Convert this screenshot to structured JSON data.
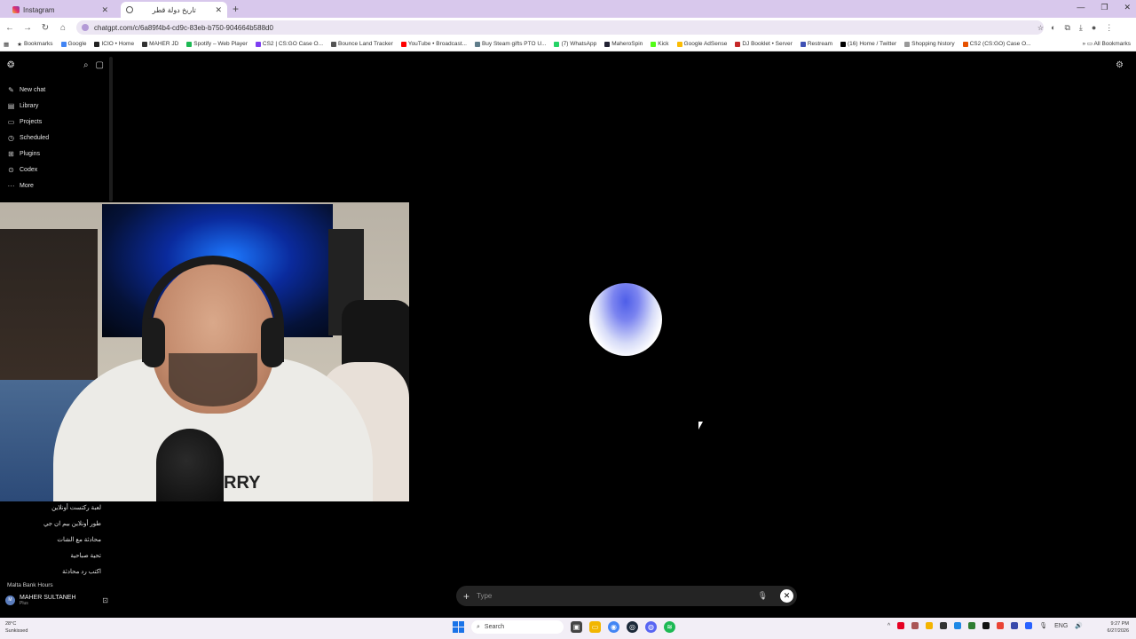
{
  "browser": {
    "tabs": [
      {
        "label": "Instagram",
        "active": false
      },
      {
        "label": "تاريخ دولة قطر",
        "active": true
      }
    ],
    "url": "chatgpt.com/c/6a89f4b4-cd9c-83eb-b750-904664b588d0",
    "bookmarks": [
      "Bookmarks",
      "Google",
      "ICIO • Home",
      "MAHER JD",
      "Spotify – Web Player",
      "CS2 | CS:GO Case O...",
      "Bounce Land Tracker",
      "YouTube • Broadcast...",
      "Buy Steam gifts PTO U...",
      "(7) WhatsApp",
      "MaheroSpin",
      "Kick",
      "Google AdSense",
      "DJ Booklet • Server",
      "Restream",
      "(16) Home / Twitter",
      "Shopping history",
      "CS2 (CS:GO) Case O..."
    ],
    "all_bookmarks": "All Bookmarks"
  },
  "sidebar": {
    "nav": [
      {
        "label": "New chat",
        "icon": "edit-icon"
      },
      {
        "label": "Library",
        "icon": "library-icon"
      },
      {
        "label": "Projects",
        "icon": "folder-icon"
      },
      {
        "label": "Scheduled",
        "icon": "clock-icon"
      },
      {
        "label": "Plugins",
        "icon": "plugin-icon"
      },
      {
        "label": "Codex",
        "icon": "codex-icon"
      },
      {
        "label": "More",
        "icon": "more-icon"
      }
    ],
    "history": [
      "لعبة ركتست أونلاين",
      "طور أونلاين بيم ان جي",
      "محادثة مع الشات",
      "تحية صباحية",
      "اكتب رد محادثة"
    ],
    "history_group": "Malta Bank Hours",
    "user": {
      "name": "MAHER SULTANEH",
      "plan": "Plus",
      "initials": "M"
    }
  },
  "composer": {
    "placeholder": "Type"
  },
  "webcam": {
    "shirt_text": "RRY"
  },
  "taskbar": {
    "weather_temp": "28°C",
    "weather_desc": "Sunkissed",
    "search_label": "Search",
    "lang": "ENG",
    "time": "9:27 PM",
    "date": "6/27/2026"
  }
}
